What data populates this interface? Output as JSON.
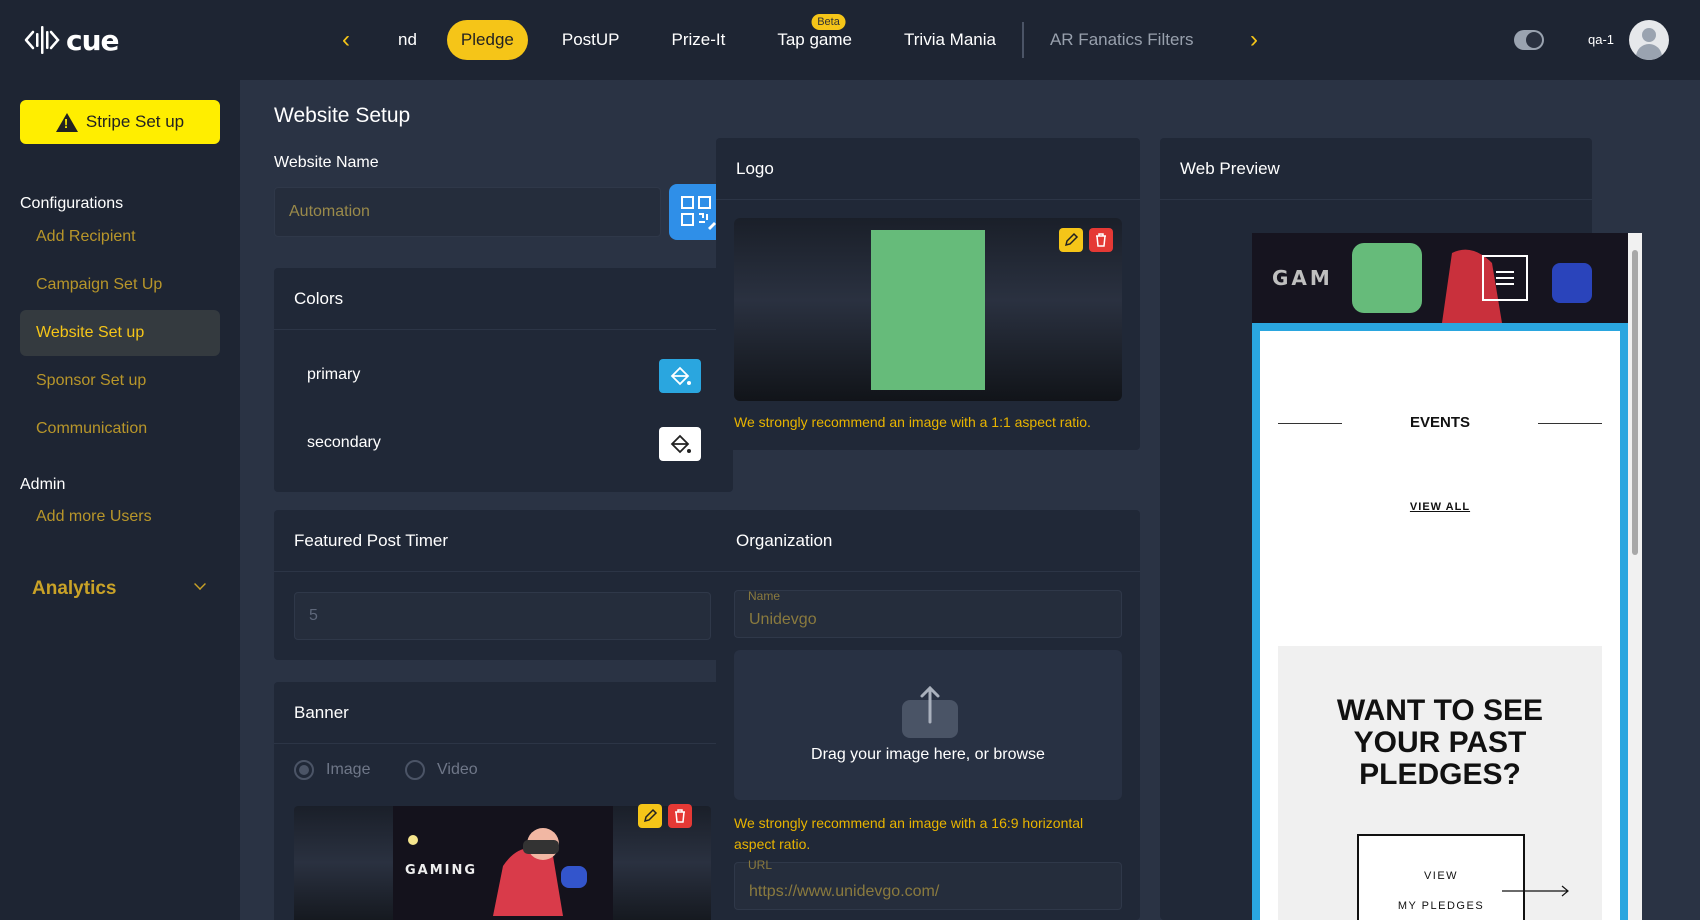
{
  "brand": {
    "name": "cue"
  },
  "nav": {
    "tabs": [
      {
        "label": "nd",
        "active": false
      },
      {
        "label": "Pledge",
        "active": true
      },
      {
        "label": "PostUP",
        "active": false
      },
      {
        "label": "Prize-It",
        "active": false
      },
      {
        "label": "Tap game",
        "badge": "Beta",
        "active": false
      },
      {
        "label": "Trivia Mania",
        "active": false
      },
      {
        "label": "AR Fanatics Filters",
        "active": false,
        "muted": true
      }
    ],
    "prev_icon": "chevron-left-icon",
    "next_icon": "chevron-right-icon"
  },
  "user": {
    "name": "qa-1"
  },
  "sidebar": {
    "stripe_button": "Stripe Set up",
    "configurations_heading": "Configurations",
    "config_items": [
      "Add Recipient",
      "Campaign Set Up",
      "Website Set up",
      "Sponsor Set up",
      "Communication"
    ],
    "active_item": "Website Set up",
    "admin_heading": "Admin",
    "admin_items": [
      "Add more Users"
    ],
    "analytics": "Analytics"
  },
  "main": {
    "title": "Website Setup",
    "website_name": {
      "label": "Website Name",
      "value": "Automation"
    },
    "colors": {
      "title": "Colors",
      "primary_label": "primary",
      "secondary_label": "secondary",
      "primary_color": "#2aa6df",
      "secondary_color": "#ffffff"
    },
    "featured_timer": {
      "title": "Featured Post Timer",
      "value": "5"
    },
    "banner": {
      "title": "Banner",
      "option_image": "Image",
      "option_video": "Video",
      "selected": "Image"
    },
    "logo": {
      "title": "Logo",
      "note": "We strongly recommend an image with a 1:1 aspect ratio."
    },
    "organization": {
      "title": "Organization",
      "name_label": "Name",
      "name_value": "Unidevgo",
      "dropzone_text": "Drag your image here, or browse",
      "note": "We strongly recommend an image with a 16:9 horizontal aspect ratio.",
      "url_label": "URL",
      "url_value": "https://www.unidevgo.com/"
    },
    "web_preview": {
      "title": "Web Preview",
      "events_heading": "EVENTS",
      "view_all": "VIEW ALL",
      "cta_heading": "WANT TO SEE YOUR PAST PLEDGES?",
      "cta_button_line1": "VIEW",
      "cta_button_line2": "MY PLEDGES"
    }
  },
  "colors": {
    "accent": "#f5c518",
    "logo_placeholder": "#66bb7a",
    "edit_button": "#f5c518",
    "delete_button": "#e53935"
  }
}
